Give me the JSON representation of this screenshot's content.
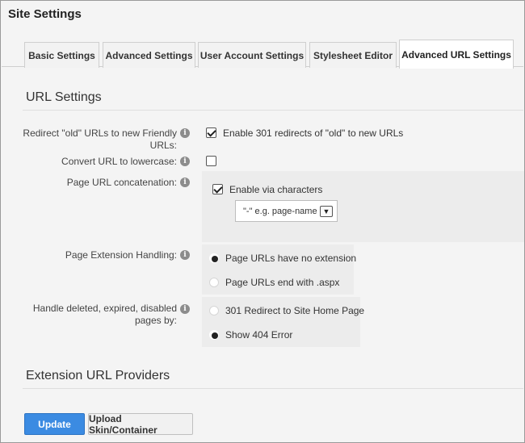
{
  "page_title": "Site Settings",
  "tabs": [
    {
      "label": "Basic Settings",
      "active": false
    },
    {
      "label": "Advanced Settings",
      "active": false
    },
    {
      "label": "User Account Settings",
      "active": false
    },
    {
      "label": "Stylesheet Editor",
      "active": false
    },
    {
      "label": "Advanced URL Settings",
      "active": true
    }
  ],
  "url_settings": {
    "title": "URL Settings",
    "redirect": {
      "label_line1": "Redirect \"old\" URLs to new Friendly",
      "label_line2": "URLs:",
      "checkbox_label": "Enable 301 redirects of \"old\" to new URLs",
      "checked": true
    },
    "lowercase": {
      "label": "Convert URL to lowercase:",
      "checked": false
    },
    "concatenation": {
      "label": "Page URL concatenation:",
      "checkbox_label": "Enable via characters",
      "checked": true,
      "select_value": "\"-\" e.g. page-name"
    },
    "extension": {
      "label": "Page Extension Handling:",
      "options": [
        {
          "label": "Page URLs have no extension",
          "selected": true
        },
        {
          "label": "Page URLs end with .aspx",
          "selected": false
        }
      ]
    },
    "deleted": {
      "label_line1": "Handle deleted, expired, disabled",
      "label_line2": "pages by:",
      "options": [
        {
          "label": "301 Redirect to Site Home Page",
          "selected": false
        },
        {
          "label": "Show 404 Error",
          "selected": true
        }
      ]
    }
  },
  "extension_providers": {
    "title": "Extension URL Providers"
  },
  "actions": {
    "update_label": "Update",
    "upload_label": "Upload Skin/Container"
  },
  "icons": {
    "info": "info-icon",
    "dropdown": "chevron-down-icon"
  },
  "colors": {
    "primary_button": "#3b8be2",
    "panel": "#ececec"
  }
}
